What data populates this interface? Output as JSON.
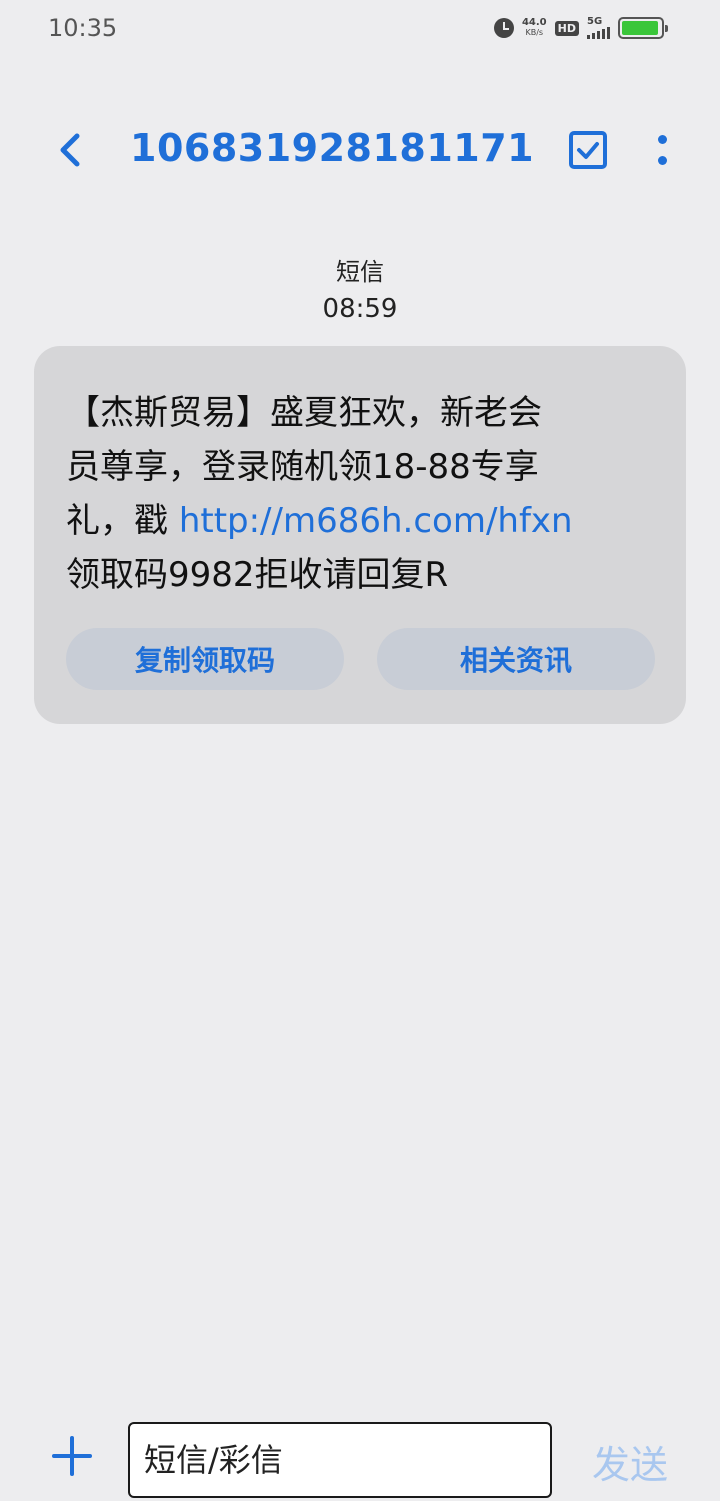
{
  "status_bar": {
    "time": "10:35",
    "net_speed_value": "44.0",
    "net_speed_unit": "KB/s",
    "hd_label": "HD",
    "network_type": "5G",
    "battery_level": 0.95,
    "battery_color": "#3ac63a"
  },
  "header": {
    "title": "106831928181171",
    "back_icon": "chevron-left-icon",
    "select_icon": "checkbox-icon",
    "more_icon": "more-vertical-icon"
  },
  "message": {
    "type_label": "短信",
    "time": "08:59",
    "line1": "【杰斯贸易】盛夏狂欢，新老会",
    "line2": "员尊享，登录随机领18-88专享",
    "line3_prefix": "礼，戳 ",
    "link": "http://m686h.com/hfxn",
    "line4": "领取码9982拒收请回复R",
    "actions": [
      "复制领取码",
      "相关资讯"
    ]
  },
  "compose": {
    "placeholder": "短信/彩信",
    "send_label": "发送",
    "add_icon": "plus-icon"
  },
  "colors": {
    "accent": "#1f6fd8",
    "send_disabled": "#a9c7ef",
    "bubble": "#d6d6d8",
    "background": "#ededef"
  }
}
